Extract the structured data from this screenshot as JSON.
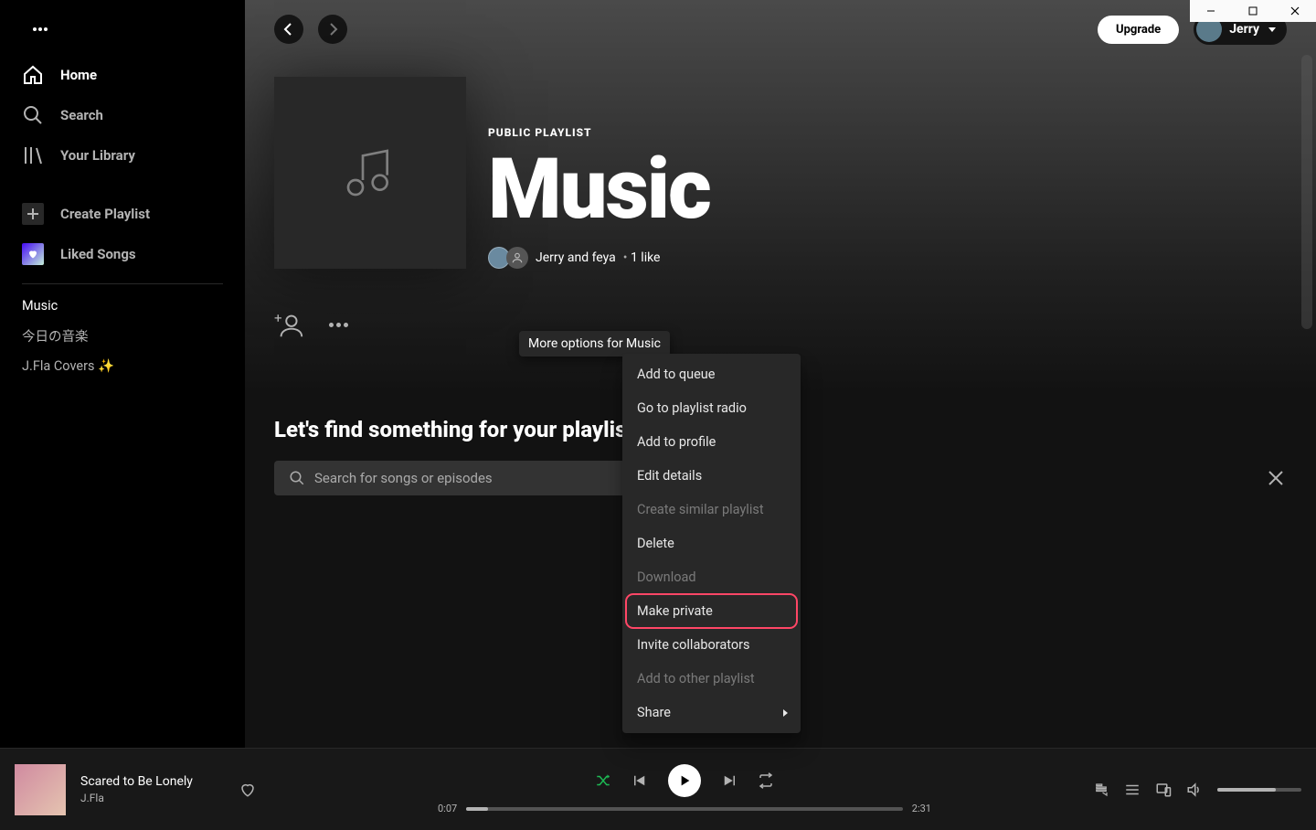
{
  "sidebar": {
    "nav": [
      {
        "label": "Home"
      },
      {
        "label": "Search"
      },
      {
        "label": "Your Library"
      }
    ],
    "create_label": "Create Playlist",
    "liked_label": "Liked Songs",
    "playlists": [
      {
        "label": "Music"
      },
      {
        "label": "今日の音楽"
      },
      {
        "label": "J.Fla Covers ✨"
      }
    ]
  },
  "topbar": {
    "upgrade": "Upgrade",
    "username": "Jerry"
  },
  "playlist": {
    "type": "PUBLIC PLAYLIST",
    "title": "Music",
    "owners": "Jerry and feya",
    "likes": "1 like"
  },
  "options_tooltip": "More options for Music",
  "context_menu": {
    "items": [
      {
        "label": "Add to queue"
      },
      {
        "label": "Go to playlist radio"
      },
      {
        "label": "Add to profile"
      },
      {
        "label": "Edit details"
      },
      {
        "label": "Create similar playlist",
        "dim": true
      },
      {
        "label": "Delete"
      },
      {
        "label": "Download",
        "dim": true
      },
      {
        "label": "Make private",
        "highlight": true
      },
      {
        "label": "Invite collaborators"
      },
      {
        "label": "Add to other playlist",
        "dim": true
      },
      {
        "label": "Share",
        "submenu": true
      }
    ]
  },
  "find": {
    "title": "Let's find something for your playlist",
    "placeholder": "Search for songs or episodes"
  },
  "player": {
    "now_title": "Scared to Be Lonely",
    "now_artist": "J.Fla",
    "elapsed": "0:07",
    "total": "2:31"
  }
}
